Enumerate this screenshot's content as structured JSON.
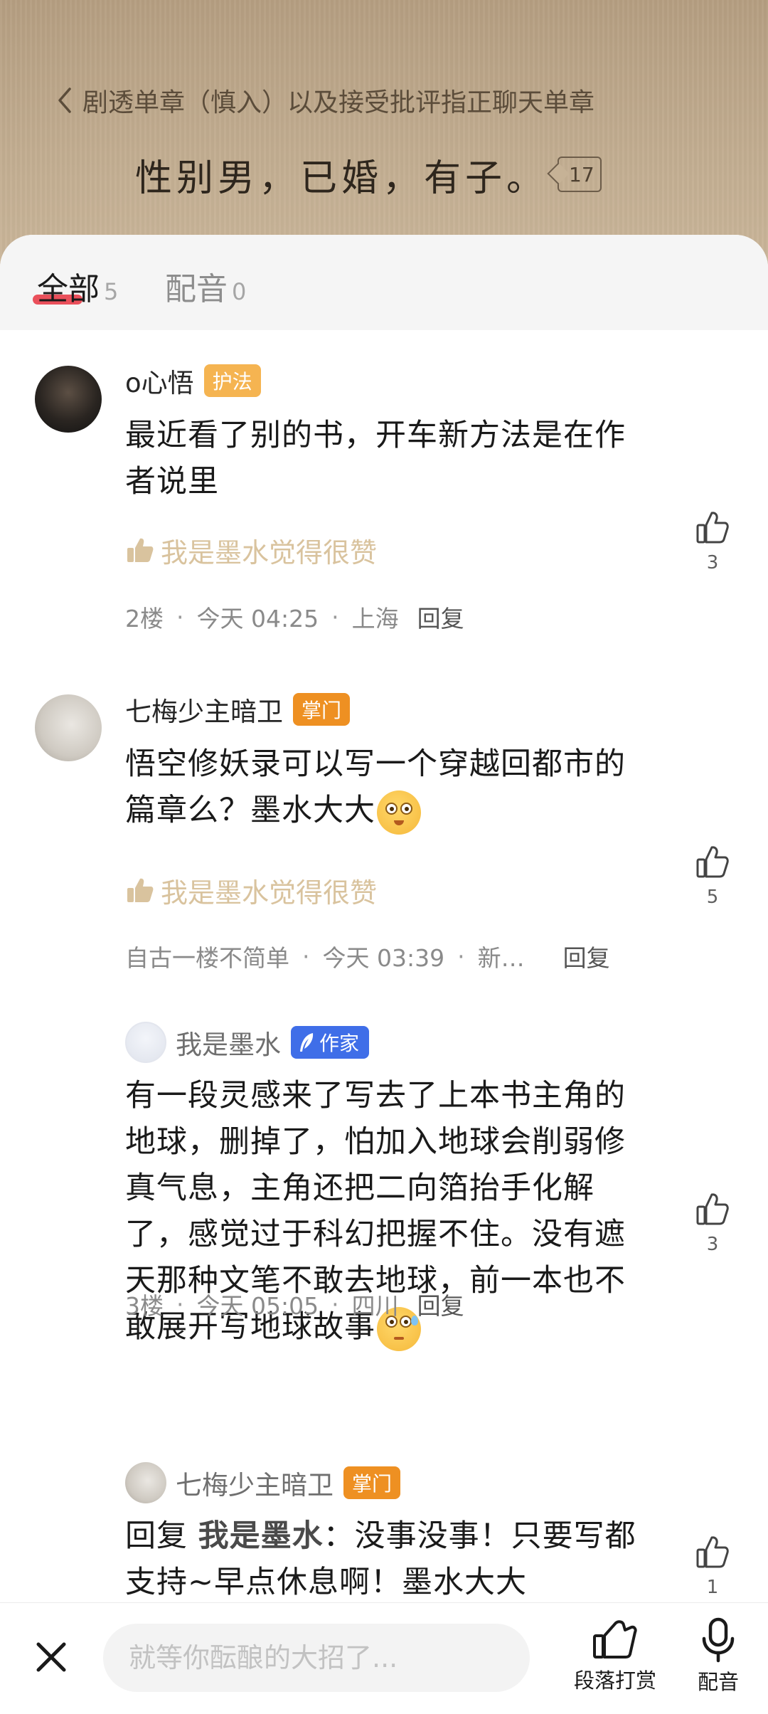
{
  "chapter": {
    "back_title": "剧透单章（慎入）以及接受批评指正聊天单章",
    "quote": "性别男，已婚，有子。",
    "paragraph_comment_count": "17"
  },
  "tabs": [
    {
      "label": "全部",
      "count": "5",
      "active": true
    },
    {
      "label": "配音",
      "count": "0",
      "active": false
    }
  ],
  "comments": [
    {
      "user": "o心悟",
      "badge": "护法",
      "text": "最近看了别的书，开车新方法是在作者说里",
      "author_like": "我是墨水觉得很赞",
      "floor": "2楼",
      "time": "今天 04:25",
      "location": "上海",
      "reply_label": "回复",
      "likes": "3"
    },
    {
      "user": "七梅少主暗卫",
      "badge": "掌门",
      "text": "悟空修妖录可以写一个穿越回都市的篇章么？墨水大大",
      "author_like": "我是墨水觉得很赞",
      "floor": "自古一楼不简单",
      "time": "今天 03:39",
      "location": "新…",
      "reply_label": "回复",
      "likes": "5"
    },
    {
      "user": "我是墨水",
      "badge": "作家",
      "text": "有一段灵感来了写去了上本书主角的地球，删掉了，怕加入地球会削弱修真气息，主角还把二向箔抬手化解了，感觉过于科幻把握不住。没有遮天那种文笔不敢去地球，前一本也不敢展开写地球故事",
      "floor": "3楼",
      "time": "今天 05:05",
      "location": "四川",
      "reply_label": "回复",
      "likes": "3"
    },
    {
      "user": "七梅少主暗卫",
      "badge": "掌门",
      "reply_prefix": "回复 ",
      "reply_to": "我是墨水",
      "text": "：没事没事！只要写都支持~早点休息啊！墨水大大",
      "likes": "1"
    }
  ],
  "bottom_bar": {
    "input_placeholder": "就等你酝酿的大招了...",
    "reward_label": "段落打赏",
    "dub_label": "配音"
  },
  "colors": {
    "badge_hufa": "#f5b451",
    "badge_zhangmen": "#ee9022",
    "badge_author": "#3f6ee8",
    "author_like_text": "#d9c39e",
    "tab_underline": "#e8333f"
  },
  "icons": [
    "chevron-left-icon",
    "thumbs-up-icon",
    "feather-icon",
    "close-icon",
    "reward-hand-icon",
    "microphone-icon"
  ]
}
